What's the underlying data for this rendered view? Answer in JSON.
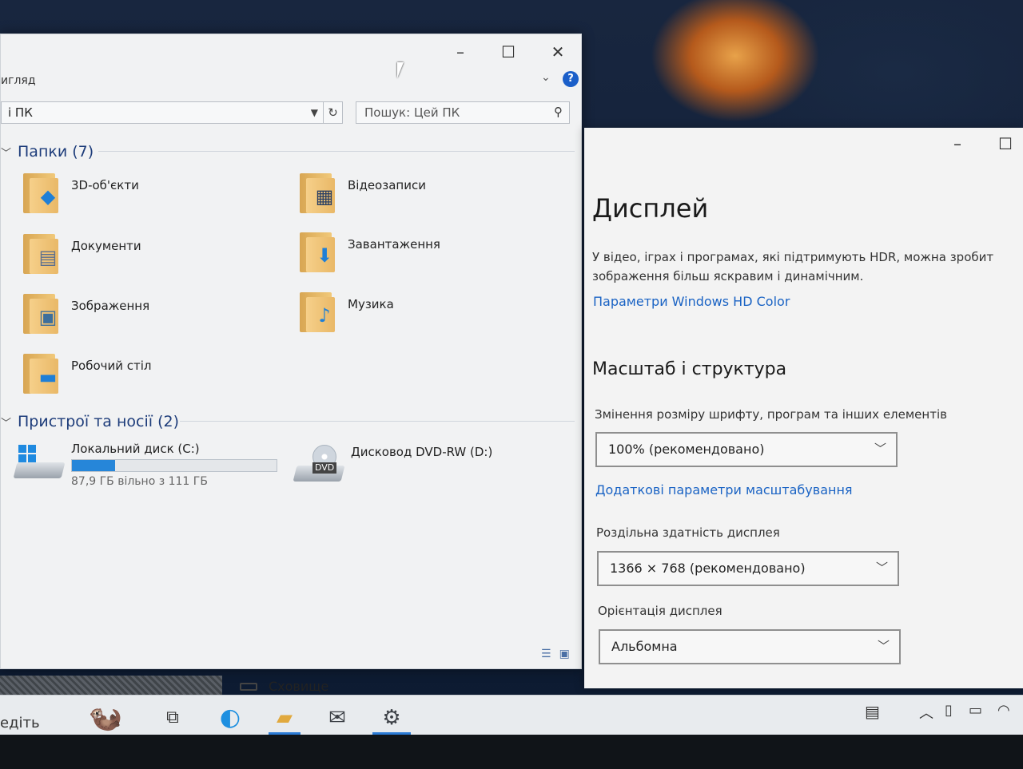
{
  "explorer": {
    "ribbon_tab": "игляд",
    "address": "і ПК",
    "search_placeholder": "Пошук: Цей ПК",
    "folders_header": "Папки (7)",
    "folders": [
      {
        "label": "3D-об'єкти",
        "icon": "3d-objects-icon"
      },
      {
        "label": "Відеозаписи",
        "icon": "videos-icon"
      },
      {
        "label": "Документи",
        "icon": "documents-icon"
      },
      {
        "label": "Завантаження",
        "icon": "downloads-icon"
      },
      {
        "label": "Зображення",
        "icon": "pictures-icon"
      },
      {
        "label": "Музика",
        "icon": "music-icon"
      },
      {
        "label": "Робочий стіл",
        "icon": "desktop-icon"
      }
    ],
    "devices_header": "Пристрої та носії (2)",
    "drives": [
      {
        "label": "Локальний диск (C:)",
        "free_text": "87,9 ГБ вільно з 111 ГБ",
        "used_fraction": 0.21
      },
      {
        "label": "Дисковод DVD-RW (D:)",
        "badge": "DVD"
      }
    ]
  },
  "settings": {
    "title": "Дисплей",
    "hdr_desc_line1": "У відео, іграх і програмах, які підтримують HDR, можна зробит",
    "hdr_desc_line2": "зображення більш яскравим і динамічним.",
    "hdr_link": "Параметри Windows HD Color",
    "scale_header": "Масштаб і структура",
    "scale_label": "Змінення розміру шрифту, програм та інших елементів",
    "scale_value": "100% (рекомендовано)",
    "advanced_scale_link": "Додаткові параметри масштабування",
    "resolution_label": "Роздільна здатність дисплея",
    "resolution_value": "1366 × 768 (рекомендовано)",
    "orientation_label": "Орієнтація дисплея",
    "orientation_value": "Альбомна"
  },
  "taskbar": {
    "search_text": "едіть",
    "storage_label": "Сховище"
  },
  "colors": {
    "accent": "#1a63c4",
    "drive_fill": "#2686d9"
  }
}
